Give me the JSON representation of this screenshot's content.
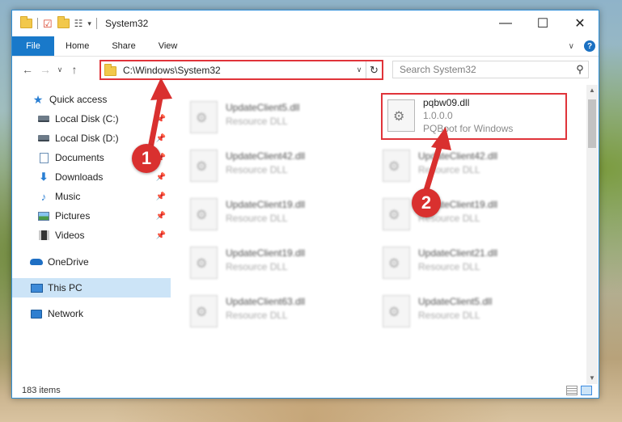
{
  "window": {
    "title": "System32",
    "controls": {
      "minimize": "—",
      "maximize": "☐",
      "close": "✕"
    }
  },
  "ribbon": {
    "tabs": [
      "File",
      "Home",
      "Share",
      "View"
    ],
    "expand": "∨",
    "help": "?"
  },
  "navbar": {
    "back": "←",
    "forward": "→",
    "recent": "∨",
    "up": "↑",
    "address": "C:\\Windows\\System32",
    "dropdown": "∨",
    "refresh": "↻",
    "search_placeholder": "Search System32",
    "search_icon": "⚲"
  },
  "sidebar": {
    "items": [
      {
        "label": "Quick access",
        "icon": "star-icon",
        "pinned": false
      },
      {
        "label": "Local Disk (C:)",
        "icon": "disk-icon",
        "pinned": true
      },
      {
        "label": "Local Disk (D:)",
        "icon": "disk-icon",
        "pinned": true
      },
      {
        "label": "Documents",
        "icon": "document-icon",
        "pinned": true
      },
      {
        "label": "Downloads",
        "icon": "download-icon",
        "pinned": true
      },
      {
        "label": "Music",
        "icon": "music-icon",
        "pinned": true
      },
      {
        "label": "Pictures",
        "icon": "pictures-icon",
        "pinned": true
      },
      {
        "label": "Videos",
        "icon": "videos-icon",
        "pinned": true
      },
      {
        "label": "OneDrive",
        "icon": "onedrive-icon",
        "pinned": false
      },
      {
        "label": "This PC",
        "icon": "pc-icon",
        "pinned": false,
        "selected": true
      },
      {
        "label": "Network",
        "icon": "network-icon",
        "pinned": false
      }
    ],
    "pin_glyph": "📌"
  },
  "files": {
    "highlighted": {
      "name": "pqbw09.dll",
      "version": "1.0.0.0",
      "description": "PQBoot for Windows"
    },
    "left_column": [
      {
        "name": "UpdateClient5.dll",
        "type": "Resource DLL"
      },
      {
        "name": "UpdateClient42.dll",
        "type": "Resource DLL"
      },
      {
        "name": "UpdateClient19.dll",
        "type": "Resource DLL"
      },
      {
        "name": "UpdateClient19.dll",
        "type": "Resource DLL"
      },
      {
        "name": "UpdateClient63.dll",
        "type": "Resource DLL"
      }
    ],
    "right_column": [
      {
        "name": "UpdateClient42.dll",
        "type": "Resource DLL"
      },
      {
        "name": "UpdateClient19.dll",
        "type": "Resource DLL"
      },
      {
        "name": "UpdateClient21.dll",
        "type": "Resource DLL"
      },
      {
        "name": "UpdateClient5.dll",
        "type": "Resource DLL"
      }
    ]
  },
  "status": {
    "item_count": "183 items"
  },
  "annotations": {
    "badge_1": "1",
    "badge_2": "2",
    "color": "#d9302f"
  }
}
